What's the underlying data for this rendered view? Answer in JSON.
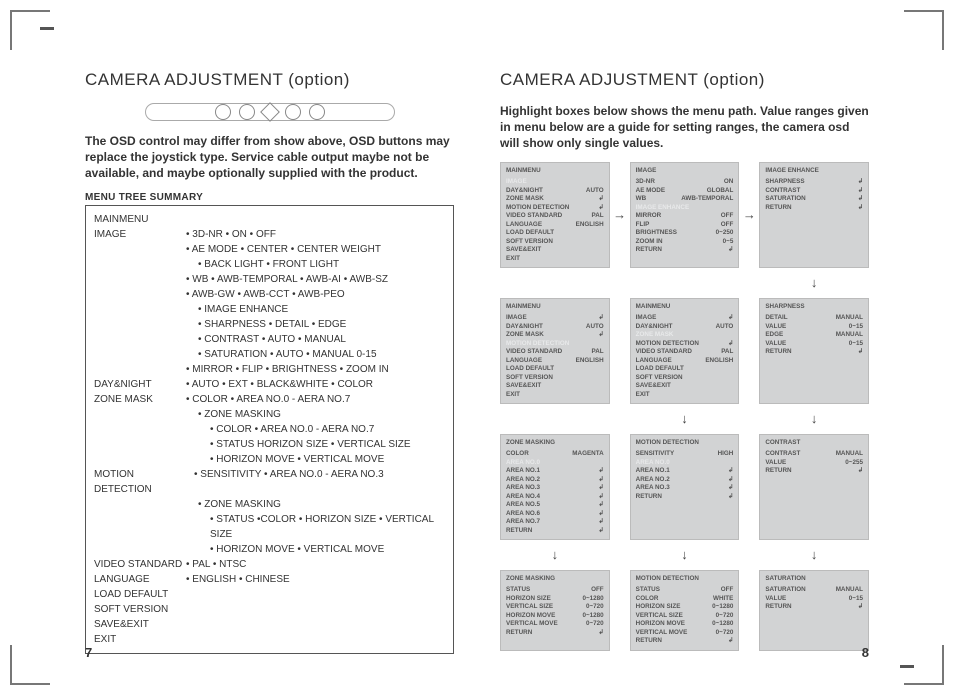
{
  "left": {
    "title": "CAMERA ADJUSTMENT (option)",
    "intro": "The OSD control may differ from show above, OSD buttons may replace the joystick type. Service cable output maybe not be available, and maybe optionally supplied with the product.",
    "tree_heading": "MENU TREE SUMMARY",
    "mainmenu_label": "MAINMENU",
    "tree": [
      {
        "k": "IMAGE",
        "v": "• 3D-NR • ON • OFF"
      },
      {
        "k": "",
        "v": "• AE MODE • CENTER • CENTER WEIGHT"
      },
      {
        "k": "",
        "v": "• BACK LIGHT • FRONT LIGHT",
        "indent": 1
      },
      {
        "k": "",
        "v": "• WB • AWB-TEMPORAL •  AWB-AI • AWB-SZ"
      },
      {
        "k": "",
        "v": "• AWB-GW • AWB-CCT • AWB-PEO"
      },
      {
        "k": "",
        "v": "• IMAGE ENHANCE",
        "indent": 1
      },
      {
        "k": "",
        "v": "• SHARPNESS • DETAIL • EDGE",
        "indent": 1
      },
      {
        "k": "",
        "v": "• CONTRAST • AUTO • MANUAL",
        "indent": 1
      },
      {
        "k": "",
        "v": "• SATURATION • AUTO • MANUAL 0-15",
        "indent": 1
      },
      {
        "k": "",
        "v": "• MIRROR • FLIP • BRIGHTNESS • ZOOM IN"
      },
      {
        "k": "DAY&NIGHT",
        "v": "• AUTO • EXT • BLACK&WHITE • COLOR"
      },
      {
        "k": "ZONE MASK",
        "v": "• COLOR • AREA NO.0 - AERA NO.7"
      },
      {
        "k": "",
        "v": "• ZONE MASKING",
        "indent": 1
      },
      {
        "k": "",
        "v": "• COLOR  • AREA NO.0 - AERA NO.7",
        "indent": 2
      },
      {
        "k": "",
        "v": "• STATUS HORIZON SIZE • VERTICAL SIZE",
        "indent": 2
      },
      {
        "k": "",
        "v": "• HORIZON MOVE • VERTICAL MOVE",
        "indent": 2
      },
      {
        "k": "MOTION DETECTION",
        "v": "• SENSITIVITY  • AREA NO.0 - AERA NO.3",
        "keywide": true
      },
      {
        "k": "",
        "v": "• ZONE MASKING",
        "indent": 1
      },
      {
        "k": "",
        "v": "• STATUS  •COLOR • HORIZON SIZE • VERTICAL SIZE",
        "indent": 2
      },
      {
        "k": "",
        "v": "• HORIZON MOVE • VERTICAL MOVE",
        "indent": 2
      },
      {
        "k": "VIDEO STANDARD",
        "v": "• PAL • NTSC"
      },
      {
        "k": "LANGUAGE",
        "v": "• ENGLISH • CHINESE"
      },
      {
        "k": "LOAD DEFAULT",
        "v": ""
      },
      {
        "k": "SOFT VERSION",
        "v": ""
      },
      {
        "k": "SAVE&EXIT",
        "v": ""
      },
      {
        "k": "EXIT",
        "v": ""
      }
    ],
    "page_no": "7"
  },
  "right": {
    "title": "CAMERA ADJUSTMENT (option)",
    "intro": "Highlight boxes below shows the menu path. Value ranges given in menu below are a guide for setting ranges, the camera osd will show only single values.",
    "page_no": "8",
    "boxes": {
      "r1c1": {
        "title": "MAINMENU",
        "rows": [
          {
            "k": "IMAGE",
            "v": "",
            "faint": true
          },
          {
            "k": "DAY&NIGHT",
            "v": "AUTO"
          },
          {
            "k": "ZONE MASK",
            "v": "↲"
          },
          {
            "k": "MOTION DETECTION",
            "v": "↲"
          },
          {
            "k": "VIDEO STANDARD",
            "v": "PAL"
          },
          {
            "k": "LANGUAGE",
            "v": "ENGLISH"
          },
          {
            "k": "LOAD DEFAULT",
            "v": ""
          },
          {
            "k": "SOFT VERSION",
            "v": ""
          },
          {
            "k": "SAVE&EXIT",
            "v": ""
          },
          {
            "k": "EXIT",
            "v": ""
          }
        ]
      },
      "r1c2": {
        "title": "IMAGE",
        "rows": [
          {
            "k": "3D-NR",
            "v": "ON"
          },
          {
            "k": "AE MODE",
            "v": "GLOBAL"
          },
          {
            "k": "WB",
            "v": "AWB-TEMPORAL"
          },
          {
            "k": "IMAGE ENHANCE",
            "v": "",
            "faint": true
          },
          {
            "k": "MIRROR",
            "v": "OFF"
          },
          {
            "k": "FLIP",
            "v": "OFF"
          },
          {
            "k": "BRIGHTNESS",
            "v": "0~250"
          },
          {
            "k": "ZOOM IN",
            "v": "0~5"
          },
          {
            "k": "RETURN",
            "v": "↲"
          }
        ]
      },
      "r1c3": {
        "title": "IMAGE ENHANCE",
        "rows": [
          {
            "k": "SHARPNESS",
            "v": "↲"
          },
          {
            "k": "CONTRAST",
            "v": "↲"
          },
          {
            "k": "SATURATION",
            "v": "↲"
          },
          {
            "k": "RETURN",
            "v": "↲"
          }
        ]
      },
      "r2c1": {
        "title": "MAINMENU",
        "rows": [
          {
            "k": "IMAGE",
            "v": "↲"
          },
          {
            "k": "DAY&NIGHT",
            "v": "AUTO"
          },
          {
            "k": "ZONE MASK",
            "v": "↲"
          },
          {
            "k": "MOTION DETECTION",
            "v": "",
            "faint": true
          },
          {
            "k": "VIDEO STANDARD",
            "v": "PAL"
          },
          {
            "k": "LANGUAGE",
            "v": "ENGLISH"
          },
          {
            "k": "LOAD DEFAULT",
            "v": ""
          },
          {
            "k": "SOFT VERSION",
            "v": ""
          },
          {
            "k": "SAVE&EXIT",
            "v": ""
          },
          {
            "k": "EXIT",
            "v": ""
          }
        ]
      },
      "r2c2": {
        "title": "MAINMENU",
        "rows": [
          {
            "k": "IMAGE",
            "v": "↲"
          },
          {
            "k": "DAY&NIGHT",
            "v": "AUTO"
          },
          {
            "k": "ZONE MASK",
            "v": "",
            "faint": true
          },
          {
            "k": "MOTION DETECTION",
            "v": "↲"
          },
          {
            "k": "VIDEO STANDARD",
            "v": "PAL"
          },
          {
            "k": "LANGUAGE",
            "v": "ENGLISH"
          },
          {
            "k": "LOAD DEFAULT",
            "v": ""
          },
          {
            "k": "SOFT VERSION",
            "v": ""
          },
          {
            "k": "SAVE&EXIT",
            "v": ""
          },
          {
            "k": "EXIT",
            "v": ""
          }
        ]
      },
      "r2c3": {
        "title": "SHARPNESS",
        "rows": [
          {
            "k": "DETAIL",
            "v": "MANUAL"
          },
          {
            "k": "  VALUE",
            "v": "0~15"
          },
          {
            "k": "EDGE",
            "v": "MANUAL"
          },
          {
            "k": "  VALUE",
            "v": "0~15"
          },
          {
            "k": "RETURN",
            "v": "↲"
          }
        ]
      },
      "r3c1": {
        "title": "ZONE MASKING",
        "rows": [
          {
            "k": "COLOR",
            "v": "MAGENTA"
          },
          {
            "k": "AREA NO.0",
            "v": "",
            "faint": true
          },
          {
            "k": "AREA NO.1",
            "v": "↲"
          },
          {
            "k": "AREA NO.2",
            "v": "↲"
          },
          {
            "k": "AREA NO.3",
            "v": "↲"
          },
          {
            "k": "AREA NO.4",
            "v": "↲"
          },
          {
            "k": "AREA NO.5",
            "v": "↲"
          },
          {
            "k": "AREA NO.6",
            "v": "↲"
          },
          {
            "k": "AREA NO.7",
            "v": "↲"
          },
          {
            "k": "RETURN",
            "v": "↲"
          }
        ]
      },
      "r3c2": {
        "title": "MOTION DETECTION",
        "rows": [
          {
            "k": "SENSITIVITY",
            "v": "HIGH"
          },
          {
            "k": "AREA NO.0",
            "v": "",
            "faint": true
          },
          {
            "k": "AREA NO.1",
            "v": "↲"
          },
          {
            "k": "AREA NO.2",
            "v": "↲"
          },
          {
            "k": "AREA NO.3",
            "v": "↲"
          },
          {
            "k": "RETURN",
            "v": "↲"
          }
        ]
      },
      "r3c3": {
        "title": "CONTRAST",
        "rows": [
          {
            "k": "CONTRAST",
            "v": "MANUAL"
          },
          {
            "k": "  VALUE",
            "v": "0~255"
          },
          {
            "k": "RETURN",
            "v": "↲"
          }
        ]
      },
      "r4c1": {
        "title": "ZONE MASKING",
        "rows": [
          {
            "k": "STATUS",
            "v": "OFF"
          },
          {
            "k": "HORIZON SIZE",
            "v": "0~1280"
          },
          {
            "k": "VERTICAL SIZE",
            "v": "0~720"
          },
          {
            "k": "HORIZON MOVE",
            "v": "0~1280"
          },
          {
            "k": "VERTICAL MOVE",
            "v": "0~720"
          },
          {
            "k": "RETURN",
            "v": "↲"
          }
        ]
      },
      "r4c2": {
        "title": "MOTION DETECTION",
        "rows": [
          {
            "k": "STATUS",
            "v": "OFF"
          },
          {
            "k": "COLOR",
            "v": "WHITE"
          },
          {
            "k": "HORIZON SIZE",
            "v": "0~1280"
          },
          {
            "k": "VERTICAL SIZE",
            "v": "0~720"
          },
          {
            "k": "HORIZON MOVE",
            "v": "0~1280"
          },
          {
            "k": "VERTICAL MOVE",
            "v": "0~720"
          },
          {
            "k": "RETURN",
            "v": "↲"
          }
        ]
      },
      "r4c3": {
        "title": "SATURATION",
        "rows": [
          {
            "k": "SATURATION",
            "v": "MANUAL"
          },
          {
            "k": "  VALUE",
            "v": "0~15"
          },
          {
            "k": "RETURN",
            "v": "↲"
          }
        ]
      }
    },
    "arrows": {
      "right": "→",
      "down": "↓"
    }
  }
}
